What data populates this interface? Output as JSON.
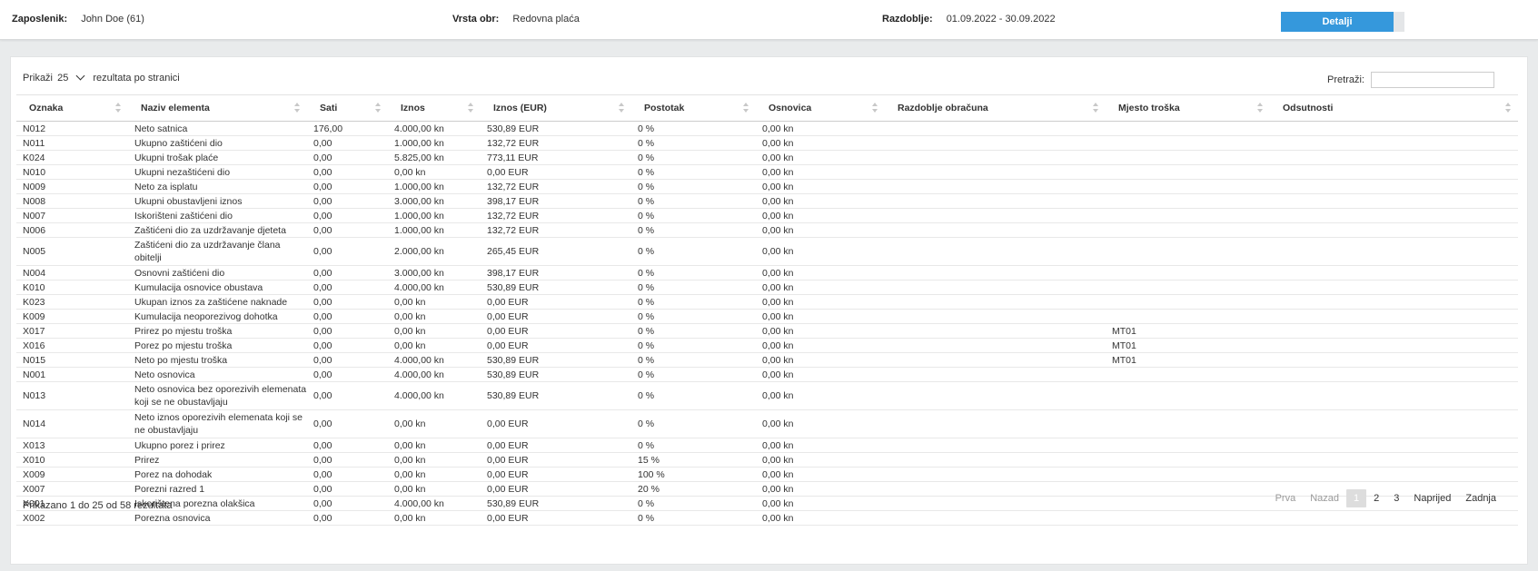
{
  "header": {
    "employee_label": "Zaposlenik:",
    "employee_value": "John Doe (61)",
    "type_label": "Vrsta obr:",
    "type_value": "Redovna plaća",
    "period_label": "Razdoblje:",
    "period_value": "01.09.2022 - 30.09.2022",
    "details_button": "Detalji"
  },
  "length": {
    "prefix": "Prikaži",
    "value": "25",
    "suffix": "rezultata po stranici"
  },
  "search": {
    "label": "Pretraži:",
    "value": ""
  },
  "columns": [
    "Oznaka",
    "Naziv elementa",
    "Sati",
    "Iznos",
    "Iznos (EUR)",
    "Postotak",
    "Osnovica",
    "Razdoblje obračuna",
    "Mjesto troška",
    "Odsutnosti"
  ],
  "rows": [
    {
      "code": "N012",
      "name": "Neto satnica",
      "hours": "176,00",
      "amount": "4.000,00 kn",
      "amount_eur": "530,89 EUR",
      "percent": "0 %",
      "base": "0,00 kn",
      "period": "",
      "cost_center": "",
      "absence": ""
    },
    {
      "code": "N011",
      "name": "Ukupno zaštićeni dio",
      "hours": "0,00",
      "amount": "1.000,00 kn",
      "amount_eur": "132,72 EUR",
      "percent": "0 %",
      "base": "0,00 kn",
      "period": "",
      "cost_center": "",
      "absence": ""
    },
    {
      "code": "K024",
      "name": "Ukupni trošak plaće",
      "hours": "0,00",
      "amount": "5.825,00 kn",
      "amount_eur": "773,11 EUR",
      "percent": "0 %",
      "base": "0,00 kn",
      "period": "",
      "cost_center": "",
      "absence": ""
    },
    {
      "code": "N010",
      "name": "Ukupni nezaštićeni dio",
      "hours": "0,00",
      "amount": "0,00 kn",
      "amount_eur": "0,00 EUR",
      "percent": "0 %",
      "base": "0,00 kn",
      "period": "",
      "cost_center": "",
      "absence": ""
    },
    {
      "code": "N009",
      "name": "Neto za isplatu",
      "hours": "0,00",
      "amount": "1.000,00 kn",
      "amount_eur": "132,72 EUR",
      "percent": "0 %",
      "base": "0,00 kn",
      "period": "",
      "cost_center": "",
      "absence": ""
    },
    {
      "code": "N008",
      "name": "Ukupni obustavljeni iznos",
      "hours": "0,00",
      "amount": "3.000,00 kn",
      "amount_eur": "398,17 EUR",
      "percent": "0 %",
      "base": "0,00 kn",
      "period": "",
      "cost_center": "",
      "absence": ""
    },
    {
      "code": "N007",
      "name": "Iskorišteni zaštićeni dio",
      "hours": "0,00",
      "amount": "1.000,00 kn",
      "amount_eur": "132,72 EUR",
      "percent": "0 %",
      "base": "0,00 kn",
      "period": "",
      "cost_center": "",
      "absence": ""
    },
    {
      "code": "N006",
      "name": "Zaštićeni dio za uzdržavanje djeteta",
      "hours": "0,00",
      "amount": "1.000,00 kn",
      "amount_eur": "132,72 EUR",
      "percent": "0 %",
      "base": "0,00 kn",
      "period": "",
      "cost_center": "",
      "absence": ""
    },
    {
      "code": "N005",
      "name": "Zaštićeni dio za uzdržavanje člana obitelji",
      "hours": "0,00",
      "amount": "2.000,00 kn",
      "amount_eur": "265,45 EUR",
      "percent": "0 %",
      "base": "0,00 kn",
      "period": "",
      "cost_center": "",
      "absence": ""
    },
    {
      "code": "N004",
      "name": "Osnovni zaštićeni dio",
      "hours": "0,00",
      "amount": "3.000,00 kn",
      "amount_eur": "398,17 EUR",
      "percent": "0 %",
      "base": "0,00 kn",
      "period": "",
      "cost_center": "",
      "absence": ""
    },
    {
      "code": "K010",
      "name": "Kumulacija osnovice obustava",
      "hours": "0,00",
      "amount": "4.000,00 kn",
      "amount_eur": "530,89 EUR",
      "percent": "0 %",
      "base": "0,00 kn",
      "period": "",
      "cost_center": "",
      "absence": ""
    },
    {
      "code": "K023",
      "name": "Ukupan iznos za zaštićene naknade",
      "hours": "0,00",
      "amount": "0,00 kn",
      "amount_eur": "0,00 EUR",
      "percent": "0 %",
      "base": "0,00 kn",
      "period": "",
      "cost_center": "",
      "absence": ""
    },
    {
      "code": "K009",
      "name": "Kumulacija neoporezivog dohotka",
      "hours": "0,00",
      "amount": "0,00 kn",
      "amount_eur": "0,00 EUR",
      "percent": "0 %",
      "base": "0,00 kn",
      "period": "",
      "cost_center": "",
      "absence": ""
    },
    {
      "code": "X017",
      "name": "Prirez po mjestu troška",
      "hours": "0,00",
      "amount": "0,00 kn",
      "amount_eur": "0,00 EUR",
      "percent": "0 %",
      "base": "0,00 kn",
      "period": "",
      "cost_center": "MT01",
      "absence": ""
    },
    {
      "code": "X016",
      "name": "Porez po mjestu troška",
      "hours": "0,00",
      "amount": "0,00 kn",
      "amount_eur": "0,00 EUR",
      "percent": "0 %",
      "base": "0,00 kn",
      "period": "",
      "cost_center": "MT01",
      "absence": ""
    },
    {
      "code": "N015",
      "name": "Neto po mjestu troška",
      "hours": "0,00",
      "amount": "4.000,00 kn",
      "amount_eur": "530,89 EUR",
      "percent": "0 %",
      "base": "0,00 kn",
      "period": "",
      "cost_center": "MT01",
      "absence": ""
    },
    {
      "code": "N001",
      "name": "Neto osnovica",
      "hours": "0,00",
      "amount": "4.000,00 kn",
      "amount_eur": "530,89 EUR",
      "percent": "0 %",
      "base": "0,00 kn",
      "period": "",
      "cost_center": "",
      "absence": ""
    },
    {
      "code": "N013",
      "name": "Neto osnovica bez oporezivih elemenata koji se ne obustavljaju",
      "hours": "0,00",
      "amount": "4.000,00 kn",
      "amount_eur": "530,89 EUR",
      "percent": "0 %",
      "base": "0,00 kn",
      "period": "",
      "cost_center": "",
      "absence": ""
    },
    {
      "code": "N014",
      "name": "Neto iznos oporezivih elemenata koji se ne obustavljaju",
      "hours": "0,00",
      "amount": "0,00 kn",
      "amount_eur": "0,00 EUR",
      "percent": "0 %",
      "base": "0,00 kn",
      "period": "",
      "cost_center": "",
      "absence": ""
    },
    {
      "code": "X013",
      "name": "Ukupno porez i prirez",
      "hours": "0,00",
      "amount": "0,00 kn",
      "amount_eur": "0,00 EUR",
      "percent": "0 %",
      "base": "0,00 kn",
      "period": "",
      "cost_center": "",
      "absence": ""
    },
    {
      "code": "X010",
      "name": "Prirez",
      "hours": "0,00",
      "amount": "0,00 kn",
      "amount_eur": "0,00 EUR",
      "percent": "15 %",
      "base": "0,00 kn",
      "period": "",
      "cost_center": "",
      "absence": ""
    },
    {
      "code": "X009",
      "name": "Porez na dohodak",
      "hours": "0,00",
      "amount": "0,00 kn",
      "amount_eur": "0,00 EUR",
      "percent": "100 %",
      "base": "0,00 kn",
      "period": "",
      "cost_center": "",
      "absence": ""
    },
    {
      "code": "X007",
      "name": "Porezni razred 1",
      "hours": "0,00",
      "amount": "0,00 kn",
      "amount_eur": "0,00 EUR",
      "percent": "20 %",
      "base": "0,00 kn",
      "period": "",
      "cost_center": "",
      "absence": ""
    },
    {
      "code": "X001",
      "name": "Iskorištena porezna olakšica",
      "hours": "0,00",
      "amount": "4.000,00 kn",
      "amount_eur": "530,89 EUR",
      "percent": "0 %",
      "base": "0,00 kn",
      "period": "",
      "cost_center": "",
      "absence": ""
    },
    {
      "code": "X002",
      "name": "Porezna osnovica",
      "hours": "0,00",
      "amount": "0,00 kn",
      "amount_eur": "0,00 EUR",
      "percent": "0 %",
      "base": "0,00 kn",
      "period": "",
      "cost_center": "",
      "absence": ""
    }
  ],
  "info": "Prikazano 1 do 25 od 58 rezultata",
  "pager": {
    "first": "Prva",
    "prev": "Nazad",
    "pages": [
      "1",
      "2",
      "3"
    ],
    "current": "1",
    "next": "Naprijed",
    "last": "Zadnja"
  }
}
